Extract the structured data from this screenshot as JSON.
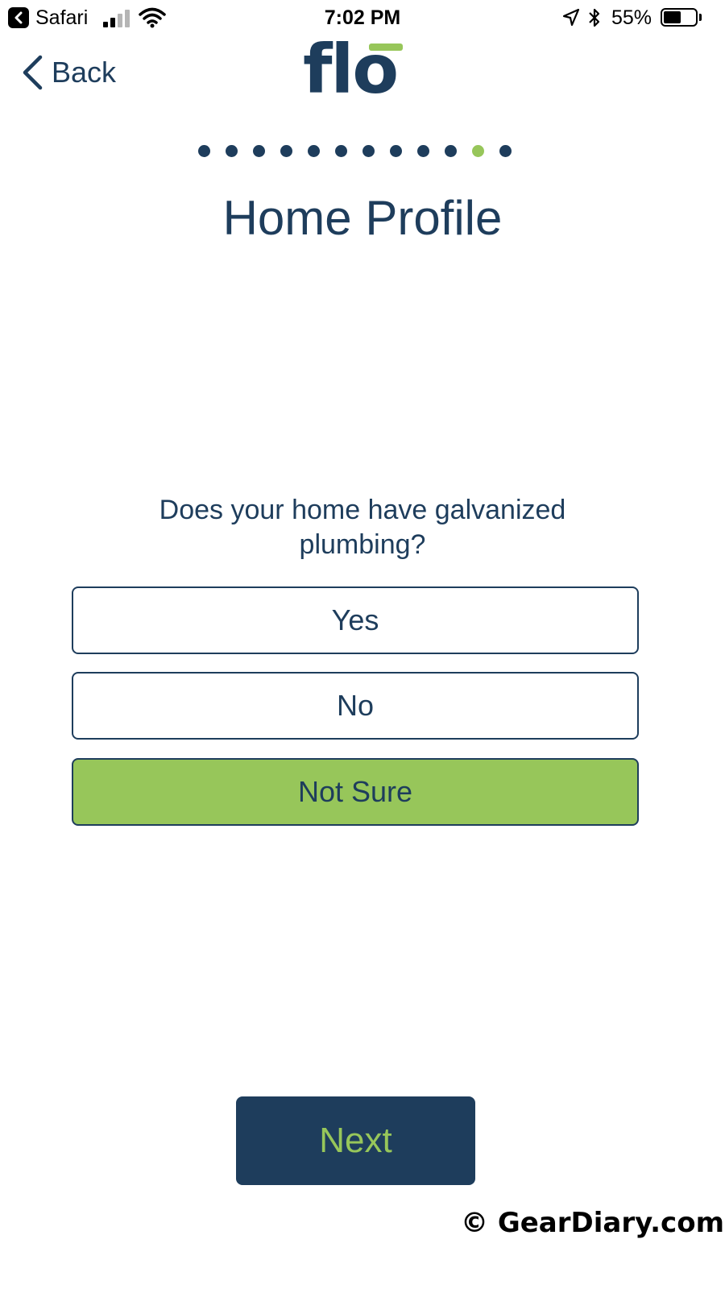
{
  "status_bar": {
    "back_app": "Safari",
    "time": "7:02 PM",
    "battery_percent": "55%",
    "battery_level": 0.55,
    "signal_bars_active": 2,
    "signal_bars_total": 4,
    "icons": [
      "back-to-app-icon",
      "cellular-signal-icon",
      "wifi-icon",
      "location-arrow-icon",
      "bluetooth-icon",
      "battery-icon"
    ]
  },
  "nav": {
    "back_label": "Back",
    "logo_text": "flo"
  },
  "progress": {
    "total_steps": 12,
    "current_step": 11
  },
  "page": {
    "title": "Home Profile",
    "question": "Does your home have galvanized plumbing?"
  },
  "options": [
    {
      "label": "Yes",
      "selected": false
    },
    {
      "label": "No",
      "selected": false
    },
    {
      "label": "Not Sure",
      "selected": true
    }
  ],
  "next_label": "Next",
  "watermark": "© GearDiary.com",
  "colors": {
    "brand_navy": "#1e3d5c",
    "brand_green": "#97c65a",
    "background": "#ffffff"
  }
}
